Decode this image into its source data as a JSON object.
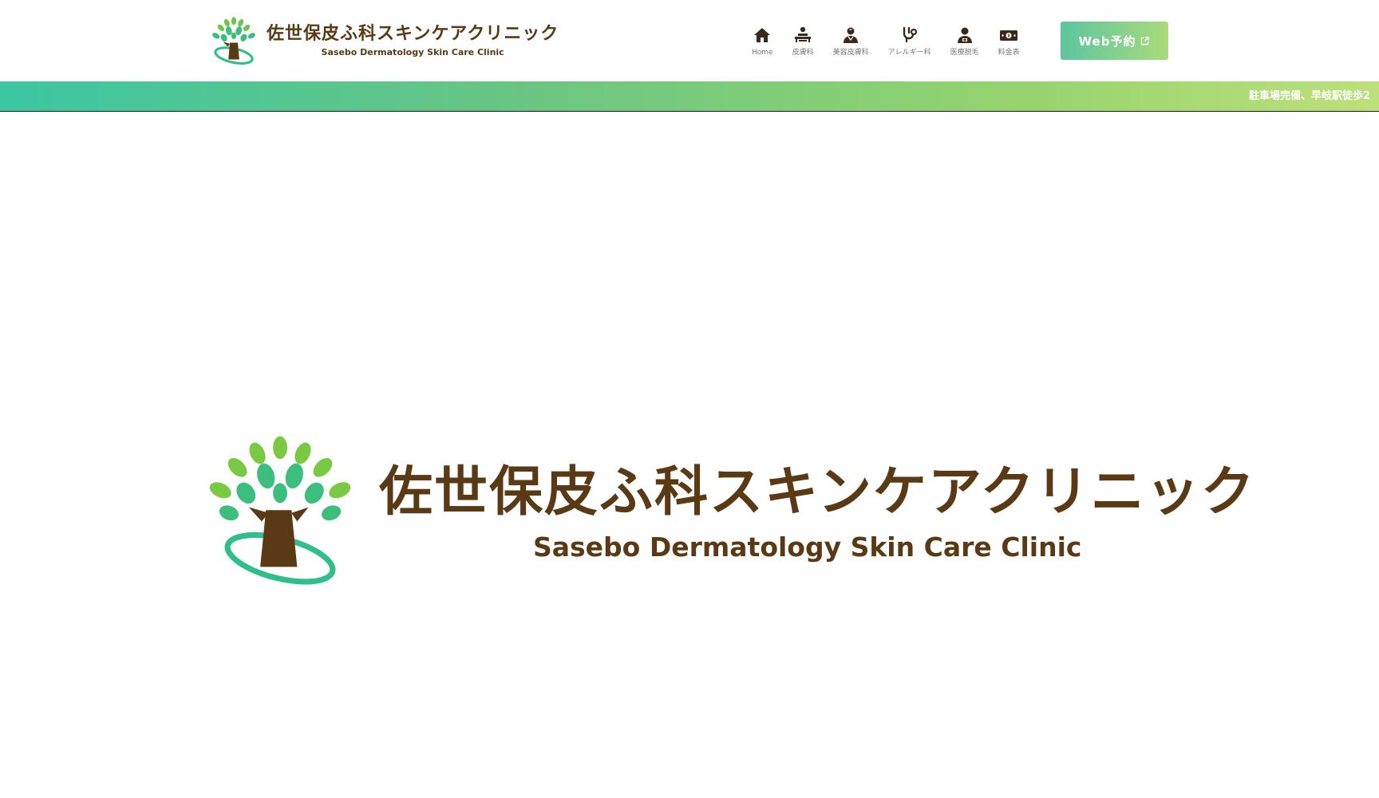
{
  "header": {
    "brand_jp": "佐世保皮ふ科スキンケアクリニック",
    "brand_en": "Sasebo Dermatology Skin Care Clinic",
    "nav": [
      {
        "label": "Home",
        "icon": "home-icon"
      },
      {
        "label": "皮膚科",
        "icon": "patient-bed-icon"
      },
      {
        "label": "美容皮膚科",
        "icon": "user-md-icon"
      },
      {
        "label": "アレルギー科",
        "icon": "stethoscope-icon"
      },
      {
        "label": "医療脱毛",
        "icon": "user-nurse-icon"
      },
      {
        "label": "料金表",
        "icon": "money-bill-icon"
      }
    ],
    "cta_label": "Web予約"
  },
  "ticker": {
    "text": "駐車場完備、早岐駅徒歩2"
  },
  "hero": {
    "logo_jp": "佐世保皮ふ科スキンケアクリニック",
    "logo_en": "Sasebo Dermatology Skin Care Clinic"
  },
  "colors": {
    "brand_brown": "#5a3a14",
    "accent_green": "#5cc5a0",
    "accent_lime": "#a9db7b"
  }
}
